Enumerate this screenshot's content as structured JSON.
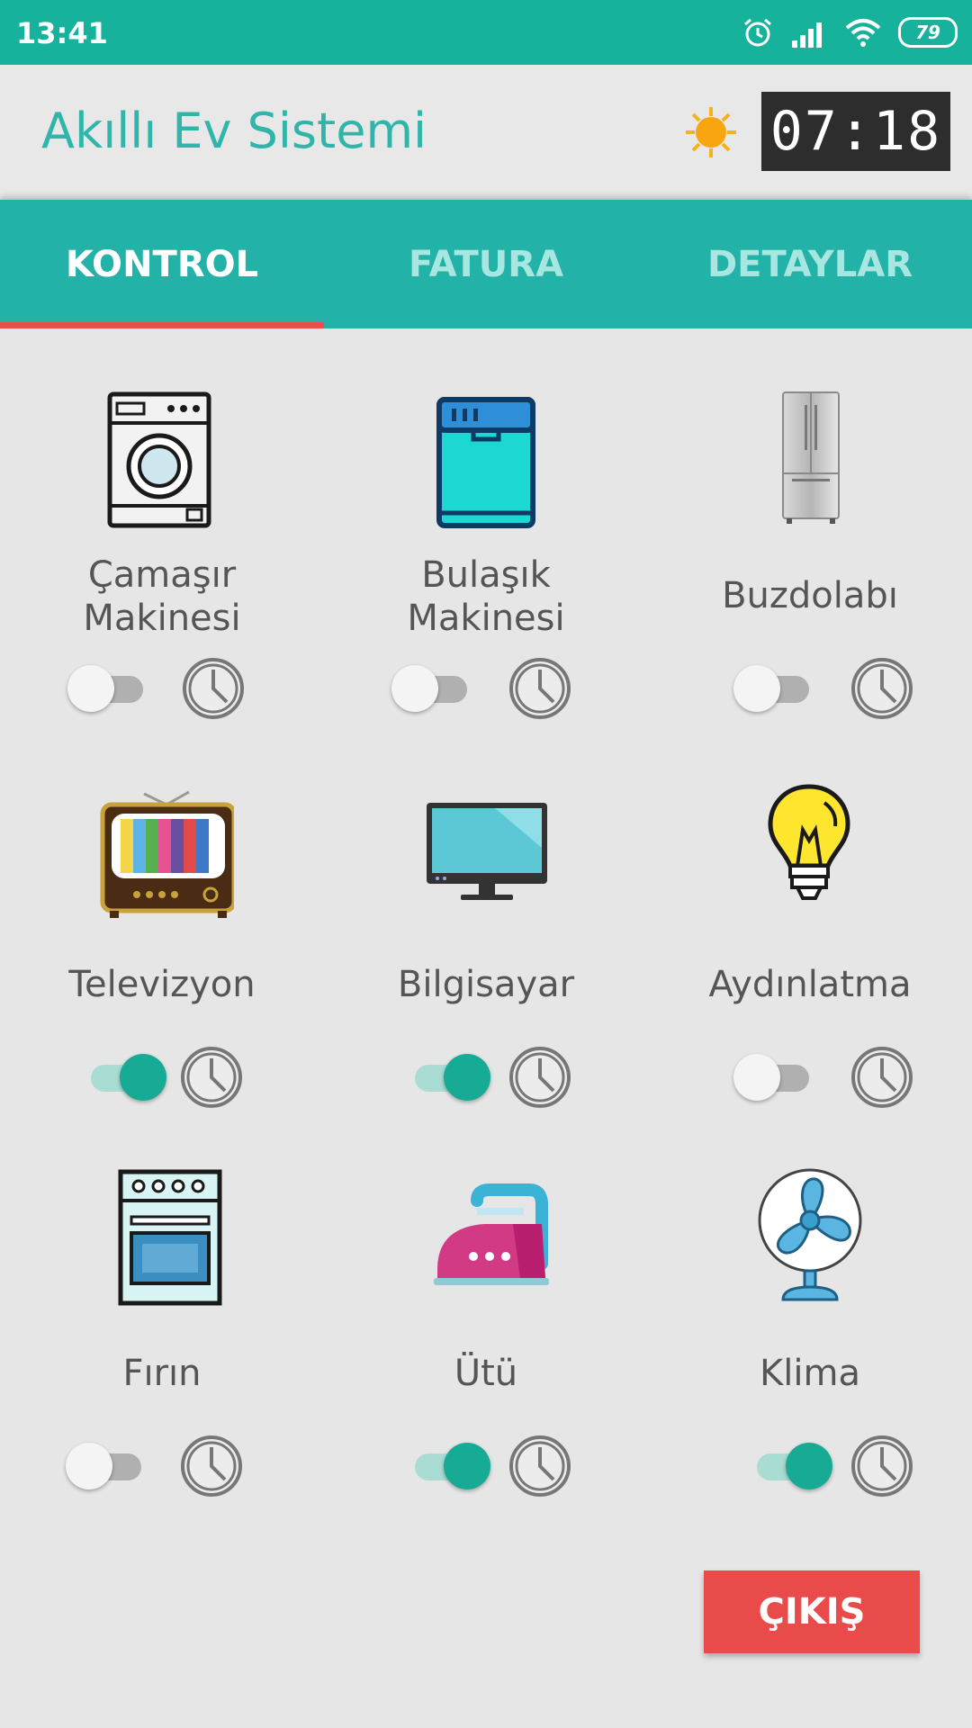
{
  "status_bar": {
    "time": "13:41",
    "battery": "79",
    "icons": [
      "alarm-icon",
      "signal-icon",
      "wifi-icon",
      "battery-icon"
    ]
  },
  "header": {
    "title": "Akıllı Ev Sistemi",
    "weather_icon": "sun-icon",
    "clock": "07:18"
  },
  "tabs": [
    {
      "label": "KONTROL",
      "active": true
    },
    {
      "label": "FATURA",
      "active": false
    },
    {
      "label": "DETAYLAR",
      "active": false
    }
  ],
  "devices": [
    {
      "name": "Çamaşır Makinesi",
      "line1": "Çamaşır",
      "line2": "Makinesi",
      "icon": "washing-machine-icon",
      "on": false
    },
    {
      "name": "Bulaşık Makinesi",
      "line1": "Bulaşık",
      "line2": "Makinesi",
      "icon": "dishwasher-icon",
      "on": false
    },
    {
      "name": "Buzdolabı",
      "line1": "Buzdolabı",
      "line2": "",
      "icon": "fridge-icon",
      "on": false
    },
    {
      "name": "Televizyon",
      "line1": "Televizyon",
      "line2": "",
      "icon": "tv-icon",
      "on": true
    },
    {
      "name": "Bilgisayar",
      "line1": "Bilgisayar",
      "line2": "",
      "icon": "monitor-icon",
      "on": true
    },
    {
      "name": "Aydınlatma",
      "line1": "Aydınlatma",
      "line2": "",
      "icon": "lightbulb-icon",
      "on": false
    },
    {
      "name": "Fırın",
      "line1": "Fırın",
      "line2": "",
      "icon": "oven-icon",
      "on": false
    },
    {
      "name": "Ütü",
      "line1": "Ütü",
      "line2": "",
      "icon": "iron-icon",
      "on": true
    },
    {
      "name": "Klima",
      "line1": "Klima",
      "line2": "",
      "icon": "fan-icon",
      "on": true
    }
  ],
  "exit_label": "ÇIKIŞ",
  "colors": {
    "primary": "#22b2a8",
    "status_bar": "#16b29b",
    "accent": "#ec4f4b",
    "switch_on": "#17ab96",
    "exit": "#e94a4a",
    "title": "#2fb5a9"
  }
}
